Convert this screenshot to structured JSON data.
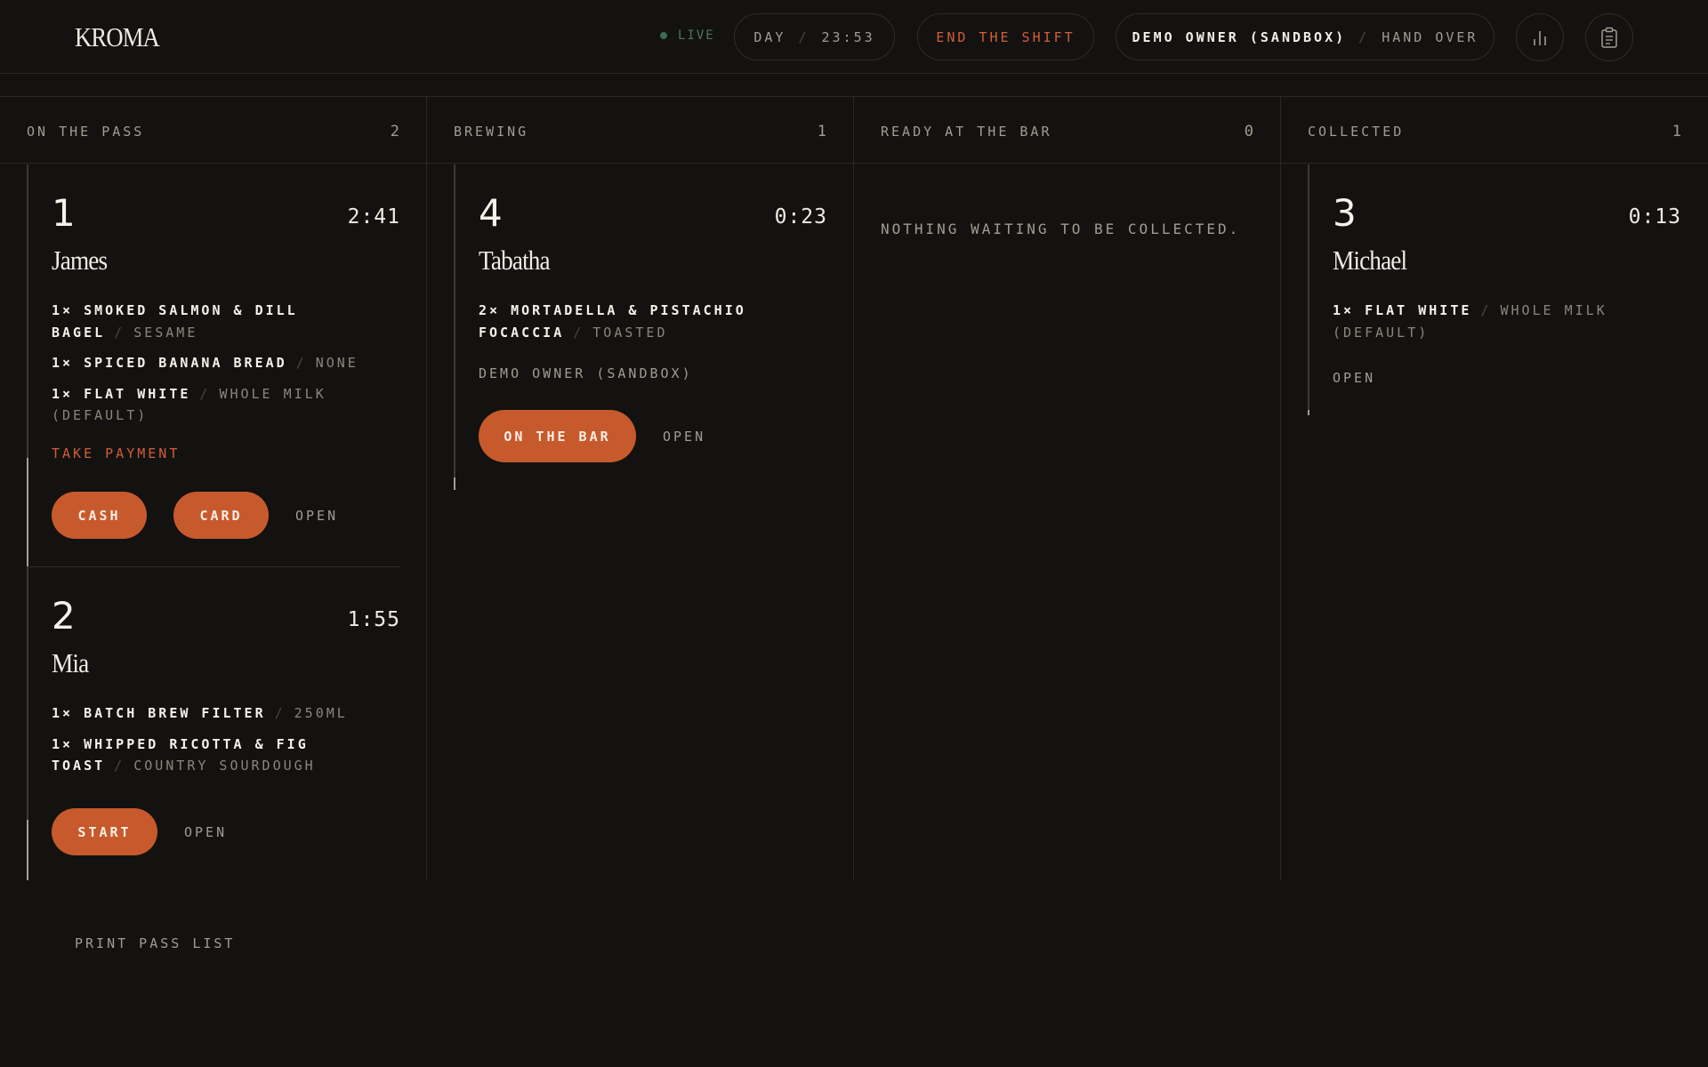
{
  "header": {
    "logo": "KROMA",
    "live_label": "LIVE",
    "shift_period": "DAY",
    "shift_time": "23:53",
    "end_shift_label": "END THE SHIFT",
    "owner_name": "DEMO OWNER (SANDBOX)",
    "hand_over_label": "HAND OVER",
    "icons": [
      "bar-chart-icon",
      "clipboard-icon"
    ]
  },
  "board": {
    "columns": [
      {
        "title": "ON THE PASS",
        "count": "2"
      },
      {
        "title": "BREWING",
        "count": "1"
      },
      {
        "title": "READY AT THE BAR",
        "count": "0"
      },
      {
        "title": "COLLECTED",
        "count": "1"
      }
    ],
    "on_the_pass": [
      {
        "number": "1",
        "timer": "2:41",
        "name": "James",
        "items": [
          {
            "qty_name": "1× SMOKED SALMON & DILL BAGEL",
            "option": "SESAME"
          },
          {
            "qty_name": "1× SPICED BANANA BREAD",
            "option": "NONE"
          },
          {
            "qty_name": "1× FLAT WHITE",
            "option": "WHOLE MILK (DEFAULT)"
          }
        ],
        "payment_prompt": "TAKE PAYMENT",
        "cash_label": "CASH",
        "card_label": "CARD",
        "open_label": "OPEN"
      },
      {
        "number": "2",
        "timer": "1:55",
        "name": "Mia",
        "items": [
          {
            "qty_name": "1× BATCH BREW FILTER",
            "option": "250ML"
          },
          {
            "qty_name": "1× WHIPPED RICOTTA & FIG TOAST",
            "option": "COUNTRY SOURDOUGH"
          }
        ],
        "start_label": "START",
        "open_label": "OPEN"
      }
    ],
    "brewing": [
      {
        "number": "4",
        "timer": "0:23",
        "name": "Tabatha",
        "items": [
          {
            "qty_name": "2× MORTADELLA & PISTACHIO FOCACCIA",
            "option": "TOASTED"
          }
        ],
        "staff": "DEMO OWNER (SANDBOX)",
        "on_bar_label": "ON THE BAR",
        "open_label": "OPEN"
      }
    ],
    "ready_empty_text": "NOTHING WAITING TO BE COLLECTED.",
    "collected": [
      {
        "number": "3",
        "timer": "0:13",
        "name": "Michael",
        "items": [
          {
            "qty_name": "1× FLAT WHITE",
            "option": "WHOLE MILK (DEFAULT)"
          }
        ],
        "open_label": "OPEN"
      }
    ]
  },
  "footer": {
    "print_label": "PRINT PASS LIST"
  },
  "colors": {
    "background": "#131210",
    "accent": "#c75a2c",
    "danger_text": "#d05e37",
    "live": "#3d6a52"
  }
}
